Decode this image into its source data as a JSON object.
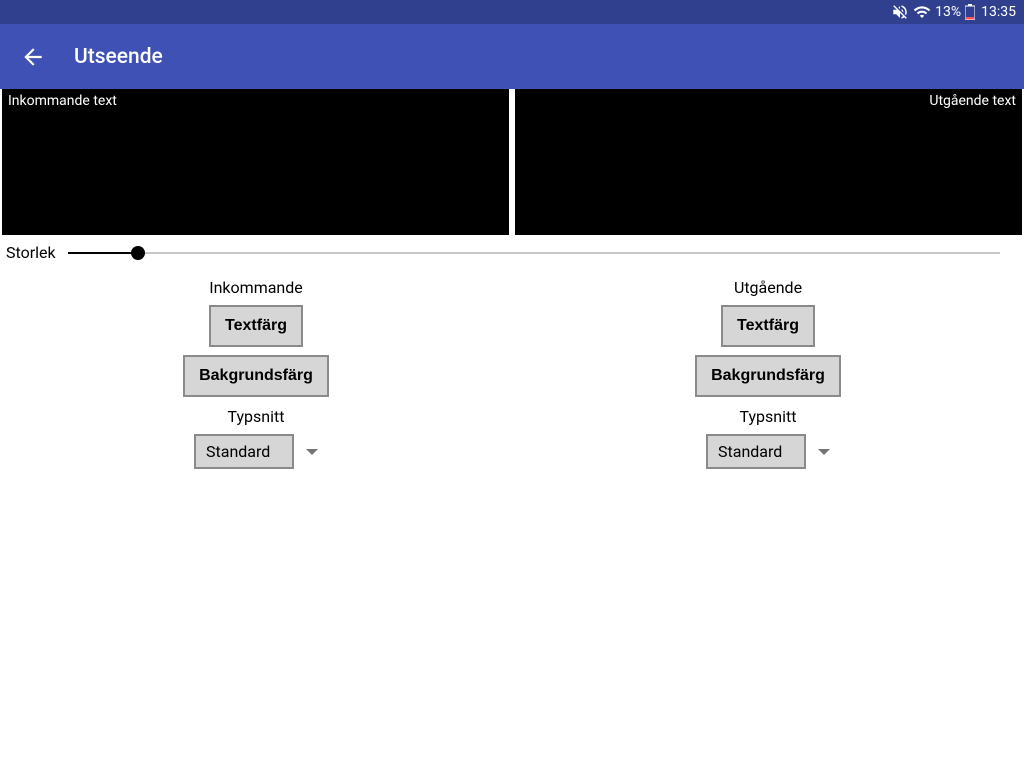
{
  "status": {
    "battery_percent": "13%",
    "time": "13:35"
  },
  "appbar": {
    "title": "Utseende"
  },
  "preview": {
    "incoming_label": "Inkommande text",
    "outgoing_label": "Utgående text"
  },
  "slider": {
    "label": "Storlek",
    "value_percent": 7.5
  },
  "incoming": {
    "heading": "Inkommande",
    "text_color_btn": "Textfärg",
    "bg_color_btn": "Bakgrundsfärg",
    "font_label": "Typsnitt",
    "font_value": "Standard"
  },
  "outgoing": {
    "heading": "Utgående",
    "text_color_btn": "Textfärg",
    "bg_color_btn": "Bakgrundsfärg",
    "font_label": "Typsnitt",
    "font_value": "Standard"
  }
}
